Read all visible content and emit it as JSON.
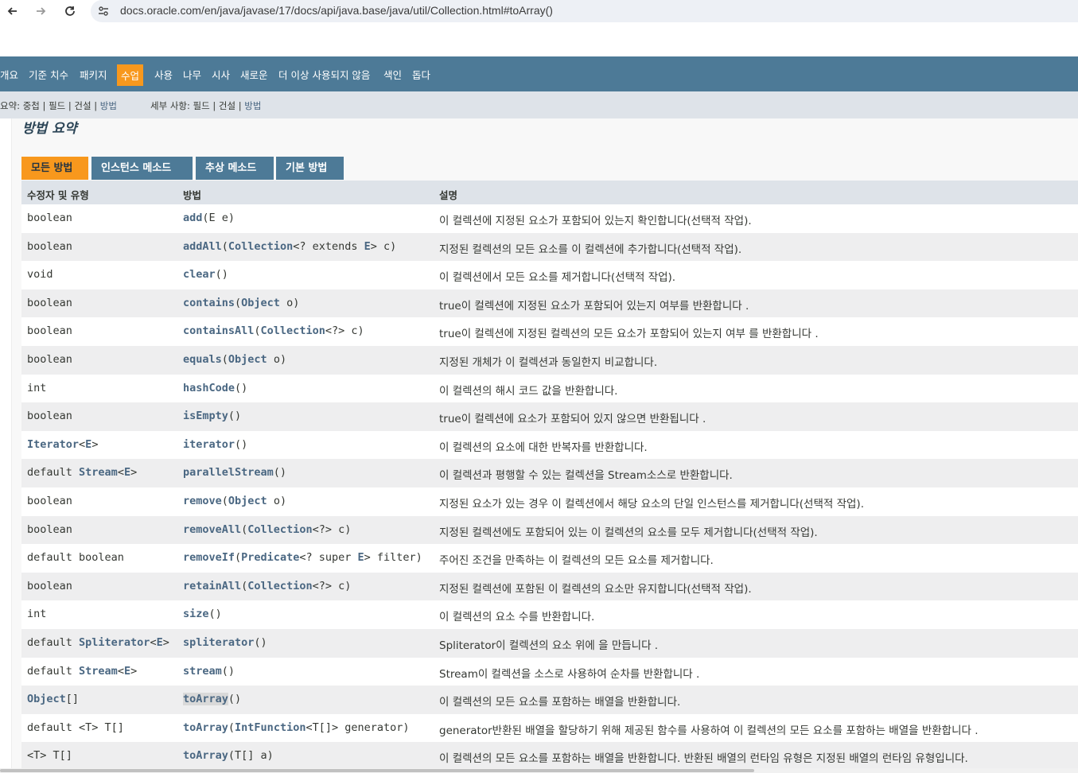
{
  "browser": {
    "url": "docs.oracle.com/en/java/javase/17/docs/api/java.base/java/util/Collection.html#toArray()"
  },
  "topnav": {
    "items": [
      "개요",
      "기준 치수",
      "패키지",
      "수업",
      "사용",
      "나무",
      "시사",
      "새로운",
      "더 이상 사용되지 않음",
      "색인",
      "돕다"
    ],
    "active_index": 3
  },
  "subnav": {
    "summary_label": "요약:",
    "summary_nested": "중첩",
    "summary_field": "필드",
    "summary_constr": "건설",
    "summary_method": "방법",
    "detail_label": "세부 사항:",
    "detail_field": "필드",
    "detail_constr": "건설",
    "detail_method": "방법",
    "sep": "|"
  },
  "section_title": "방법 요약",
  "tabs": [
    "모든 방법",
    "인스턴스 메소드",
    "추상 메소드",
    "기본 방법"
  ],
  "table": {
    "headers": [
      "수정자 및 유형",
      "방법",
      "설명"
    ],
    "rows": [
      {
        "type": [
          {
            "t": "boolean"
          }
        ],
        "method": [
          {
            "t": "add",
            "l": 1
          },
          {
            "t": "(E e)"
          }
        ],
        "desc": "이 컬렉션에 지정된 요소가 포함되어 있는지 확인합니다(선택적 작업)."
      },
      {
        "type": [
          {
            "t": "boolean"
          }
        ],
        "method": [
          {
            "t": "addAll",
            "l": 1
          },
          {
            "t": "("
          },
          {
            "t": "Collection",
            "l": 1
          },
          {
            "t": "<? extends "
          },
          {
            "t": "E",
            "l": 1
          },
          {
            "t": "> c)"
          }
        ],
        "desc": "지정된 컬렉션의 모든 요소를 이 컬렉션에 추가합니다(선택적 작업)."
      },
      {
        "type": [
          {
            "t": "void"
          }
        ],
        "method": [
          {
            "t": "clear",
            "l": 1
          },
          {
            "t": "()"
          }
        ],
        "desc": "이 컬렉션에서 모든 요소를 제거합니다(선택적 작업)."
      },
      {
        "type": [
          {
            "t": "boolean"
          }
        ],
        "method": [
          {
            "t": "contains",
            "l": 1
          },
          {
            "t": "("
          },
          {
            "t": "Object",
            "l": 1
          },
          {
            "t": " o)"
          }
        ],
        "desc": "true이 컬렉션에 지정된 요소가 포함되어 있는지 여부를 반환합니다 ."
      },
      {
        "type": [
          {
            "t": "boolean"
          }
        ],
        "method": [
          {
            "t": "containsAll",
            "l": 1
          },
          {
            "t": "("
          },
          {
            "t": "Collection",
            "l": 1
          },
          {
            "t": "<?> c)"
          }
        ],
        "desc": "true이 컬렉션에 지정된 컬렉션의 모든 요소가 포함되어 있는지 여부 를 반환합니다 ."
      },
      {
        "type": [
          {
            "t": "boolean"
          }
        ],
        "method": [
          {
            "t": "equals",
            "l": 1
          },
          {
            "t": "("
          },
          {
            "t": "Object",
            "l": 1
          },
          {
            "t": " o)"
          }
        ],
        "desc": "지정된 개체가 이 컬렉션과 동일한지 비교합니다."
      },
      {
        "type": [
          {
            "t": "int"
          }
        ],
        "method": [
          {
            "t": "hashCode",
            "l": 1
          },
          {
            "t": "()"
          }
        ],
        "desc": "이 컬렉션의 해시 코드 값을 반환합니다."
      },
      {
        "type": [
          {
            "t": "boolean"
          }
        ],
        "method": [
          {
            "t": "isEmpty",
            "l": 1
          },
          {
            "t": "()"
          }
        ],
        "desc": "true이 컬렉션에 요소가 포함되어 있지 않으면 반환됩니다 ."
      },
      {
        "type": [
          {
            "t": "Iterator",
            "l": 1
          },
          {
            "t": "<"
          },
          {
            "t": "E",
            "l": 1
          },
          {
            "t": ">"
          }
        ],
        "method": [
          {
            "t": "iterator",
            "l": 1
          },
          {
            "t": "()"
          }
        ],
        "desc": "이 컬렉션의 요소에 대한 반복자를 반환합니다."
      },
      {
        "type": [
          {
            "t": "default "
          },
          {
            "t": "Stream",
            "l": 1
          },
          {
            "t": "<"
          },
          {
            "t": "E",
            "l": 1
          },
          {
            "t": ">"
          }
        ],
        "method": [
          {
            "t": "parallelStream",
            "l": 1
          },
          {
            "t": "()"
          }
        ],
        "desc": "이 컬렉션과 평행할 수 있는 컬렉션을 Stream소스로 반환합니다."
      },
      {
        "type": [
          {
            "t": "boolean"
          }
        ],
        "method": [
          {
            "t": "remove",
            "l": 1
          },
          {
            "t": "("
          },
          {
            "t": "Object",
            "l": 1
          },
          {
            "t": " o)"
          }
        ],
        "desc": "지정된 요소가 있는 경우 이 컬렉션에서 해당 요소의 단일 인스턴스를 제거합니다(선택적 작업)."
      },
      {
        "type": [
          {
            "t": "boolean"
          }
        ],
        "method": [
          {
            "t": "removeAll",
            "l": 1
          },
          {
            "t": "("
          },
          {
            "t": "Collection",
            "l": 1
          },
          {
            "t": "<?> c)"
          }
        ],
        "desc": "지정된 컬렉션에도 포함되어 있는 이 컬렉션의 요소를 모두 제거합니다(선택적 작업)."
      },
      {
        "type": [
          {
            "t": "default boolean"
          }
        ],
        "method": [
          {
            "t": "removeIf",
            "l": 1
          },
          {
            "t": "("
          },
          {
            "t": "Predicate",
            "l": 1
          },
          {
            "t": "<? super "
          },
          {
            "t": "E",
            "l": 1
          },
          {
            "t": "> filter)"
          }
        ],
        "desc": "주어진 조건을 만족하는 이 컬렉션의 모든 요소를 제거합니다."
      },
      {
        "type": [
          {
            "t": "boolean"
          }
        ],
        "method": [
          {
            "t": "retainAll",
            "l": 1
          },
          {
            "t": "("
          },
          {
            "t": "Collection",
            "l": 1
          },
          {
            "t": "<?> c)"
          }
        ],
        "desc": "지정된 컬렉션에 포함된 이 컬렉션의 요소만 유지합니다(선택적 작업)."
      },
      {
        "type": [
          {
            "t": "int"
          }
        ],
        "method": [
          {
            "t": "size",
            "l": 1
          },
          {
            "t": "()"
          }
        ],
        "desc": "이 컬렉션의 요소 수를 반환합니다."
      },
      {
        "type": [
          {
            "t": "default "
          },
          {
            "t": "Spliterator",
            "l": 1
          },
          {
            "t": "<"
          },
          {
            "t": "E",
            "l": 1
          },
          {
            "t": ">"
          }
        ],
        "method": [
          {
            "t": "spliterator",
            "l": 1
          },
          {
            "t": "()"
          }
        ],
        "desc": "Spliterator이 컬렉션의 요소 위에 을 만듭니다 ."
      },
      {
        "type": [
          {
            "t": "default "
          },
          {
            "t": "Stream",
            "l": 1
          },
          {
            "t": "<"
          },
          {
            "t": "E",
            "l": 1
          },
          {
            "t": ">"
          }
        ],
        "method": [
          {
            "t": "stream",
            "l": 1
          },
          {
            "t": "()"
          }
        ],
        "desc": "Stream이 컬렉션을 소스로 사용하여 순차를 반환합니다 ."
      },
      {
        "type": [
          {
            "t": "Object",
            "l": 1
          },
          {
            "t": "[]"
          }
        ],
        "method": [
          {
            "t": "toArray",
            "l": 1,
            "h": 1
          },
          {
            "t": "()"
          }
        ],
        "desc": "이 컬렉션의 모든 요소를 포함하는 배열을 반환합니다."
      },
      {
        "type": [
          {
            "t": "default <T> T[]"
          }
        ],
        "method": [
          {
            "t": "toArray",
            "l": 1
          },
          {
            "t": "("
          },
          {
            "t": "IntFunction",
            "l": 1
          },
          {
            "t": "<T[]> generator)"
          }
        ],
        "desc": "generator반환된 배열을 할당하기 위해 제공된 함수를 사용하여 이 컬렉션의 모든 요소를 포함하는 배열을 반환합니다 ."
      },
      {
        "type": [
          {
            "t": "<T> T[]"
          }
        ],
        "method": [
          {
            "t": "toArray",
            "l": 1
          },
          {
            "t": "(T[] a)"
          }
        ],
        "desc": "이 컬렉션의 모든 요소를 포함하는 배열을 반환합니다. 반환된 배열의 런타임 유형은 지정된 배열의 런타임 유형입니다."
      }
    ]
  }
}
